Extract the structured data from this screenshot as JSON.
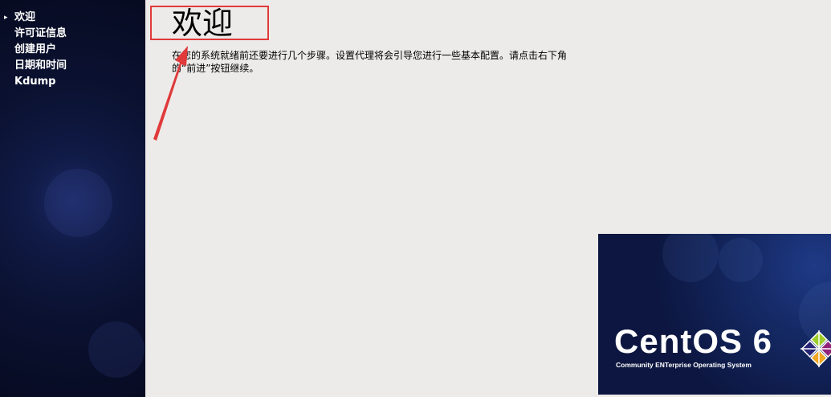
{
  "sidebar": {
    "steps": [
      {
        "label": "欢迎",
        "current": true
      },
      {
        "label": "许可证信息"
      },
      {
        "label": "创建用户"
      },
      {
        "label": "日期和时间"
      },
      {
        "label": "Kdump"
      }
    ],
    "current_marker": "▸"
  },
  "main": {
    "title": "欢迎",
    "description": "在您的系统就绪前还要进行几个步骤。设置代理将会引导您进行一些基本配置。请点击右下角的“前进”按钮继续。"
  },
  "logo": {
    "brand": "CentOS 6",
    "tagline": "Community ENTerprise Operating System"
  },
  "colors": {
    "sidebar_bg": "#0b1232",
    "content_bg": "#edebe9",
    "annotation_red": "#e03a3a",
    "emblem": [
      "#9ccd2a",
      "#932279",
      "#efa724",
      "#262577"
    ]
  }
}
